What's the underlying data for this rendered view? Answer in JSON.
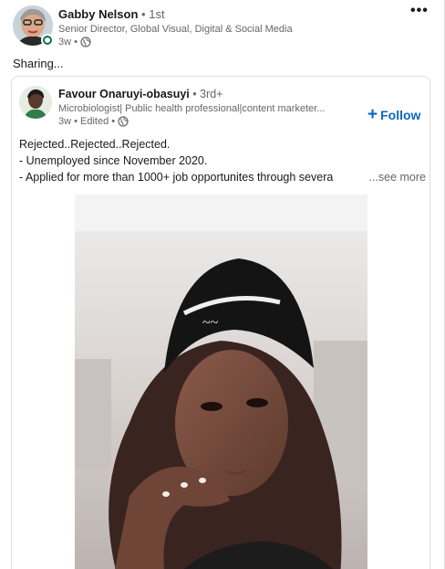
{
  "post": {
    "author": {
      "name": "Gabby Nelson",
      "degree": "• 1st",
      "headline": "Senior Director, Global Visual, Digital & Social Media",
      "time": "3w •",
      "visibility_icon": "globe-icon",
      "online_status": "online"
    },
    "overflow_menu": "•••",
    "commentary": "Sharing..."
  },
  "reshare": {
    "author": {
      "name": "Favour Onaruyi-obasuyi",
      "degree": "• 3rd+",
      "headline": "Microbiologist| Public health professional|content marketer...",
      "time": "3w • Edited •",
      "visibility_icon": "globe-icon"
    },
    "follow": {
      "icon": "+",
      "label": "Follow"
    },
    "text": {
      "line1": "Rejected..Rejected..Rejected.",
      "line2": "- Unemployed since November 2020.",
      "line3": "- Applied for more than 1000+ job opportunites through severa",
      "see_more": "...see more"
    }
  },
  "colors": {
    "link_blue": "#0a66c2",
    "secondary_text": "#666666",
    "online_green": "#057642",
    "border": "#e0dfdc"
  }
}
